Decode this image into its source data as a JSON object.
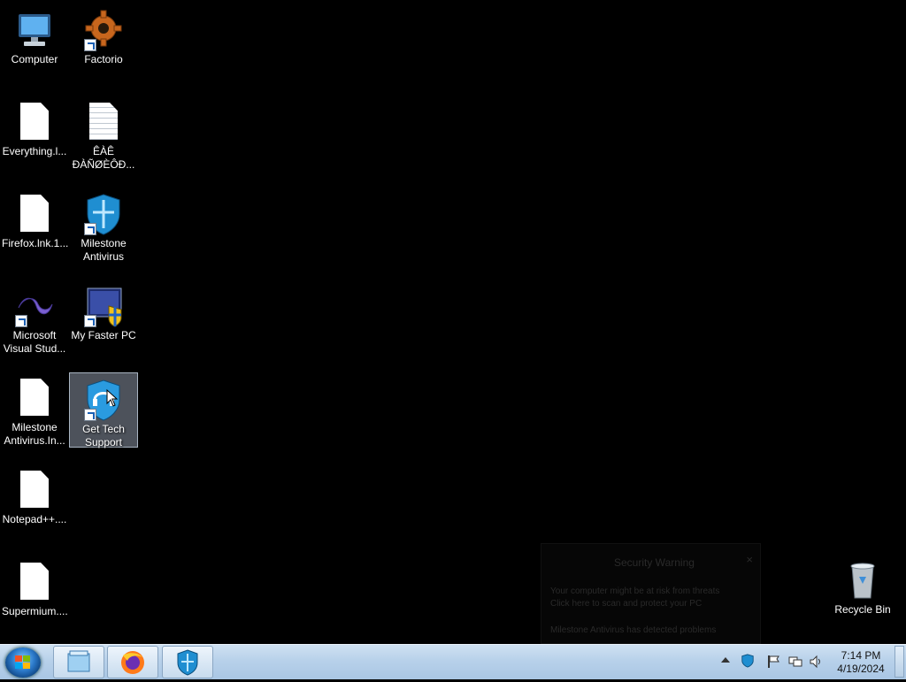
{
  "desktop": {
    "icons": [
      {
        "label": "Computer"
      },
      {
        "label": "Factorio"
      },
      {
        "label": "Everything.l..."
      },
      {
        "label": "ÊÀÊ ÐÀÑØÈÔÐ..."
      },
      {
        "label": "Firefox.lnk.1..."
      },
      {
        "label": "Milestone Antivirus"
      },
      {
        "label": "Microsoft Visual Stud..."
      },
      {
        "label": "My Faster PC"
      },
      {
        "label": "Milestone Antivirus.In..."
      },
      {
        "label": "Get Tech Support"
      },
      {
        "label": "Notepad++...."
      },
      {
        "label": "Supermium...."
      },
      {
        "label": "Recycle Bin"
      }
    ]
  },
  "notification": {
    "title": "Security Warning",
    "line1": "Your computer might be at risk from threats",
    "line2": "Click here to scan and protect your PC",
    "line3": "Milestone Antivirus has detected problems"
  },
  "taskbar": {
    "pinned": [
      "windows-explorer",
      "firefox",
      "milestone-antivirus"
    ]
  },
  "clock": {
    "time": "7:14 PM",
    "date": "4/19/2024"
  },
  "colors": {
    "desktop_bg": "#000000",
    "taskbar": "#b8d1ea",
    "selection": "#8c96a5"
  }
}
